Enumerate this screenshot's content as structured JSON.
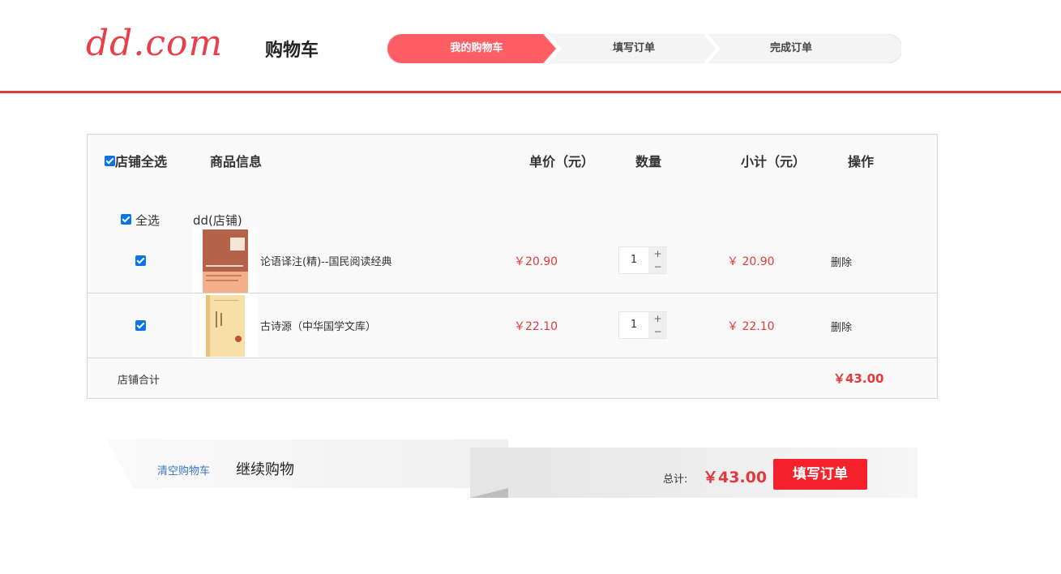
{
  "header": {
    "logo_text": "dd.com",
    "title": "购物车",
    "steps": [
      {
        "label": "我的购物车",
        "active": true
      },
      {
        "label": "填写订单",
        "active": false
      },
      {
        "label": "完成订单",
        "active": false
      }
    ],
    "accent_color": "#e5393f"
  },
  "cart": {
    "columns": {
      "select_all_shop": "店铺全选",
      "product_info": "商品信息",
      "unit_price": "单价（元）",
      "quantity": "数量",
      "subtotal": "小计（元）",
      "action": "操作"
    },
    "shop": {
      "select_all": "全选",
      "name": "dd(店铺)"
    },
    "items": [
      {
        "name": "论语译注(精)--国民阅读经典",
        "price": "￥20.90",
        "quantity": "1",
        "subtotal": "￥ 20.90",
        "delete_label": "删除",
        "checked": true,
        "cover_icon": "book-cover-icon"
      },
      {
        "name": "古诗源（中华国学文库）",
        "price": "￥22.10",
        "quantity": "1",
        "subtotal": "￥ 22.10",
        "delete_label": "删除",
        "checked": true,
        "cover_icon": "book-cover-icon"
      }
    ],
    "qty_plus": "+",
    "qty_minus": "−",
    "shop_total_label": "店铺合计",
    "shop_total_value": "￥43.00"
  },
  "footer": {
    "clear_cart": "清空购物车",
    "continue_shopping": "继续购物",
    "total_label": "总计:",
    "total_value": "￥43.00",
    "submit_label": "填写订单"
  }
}
